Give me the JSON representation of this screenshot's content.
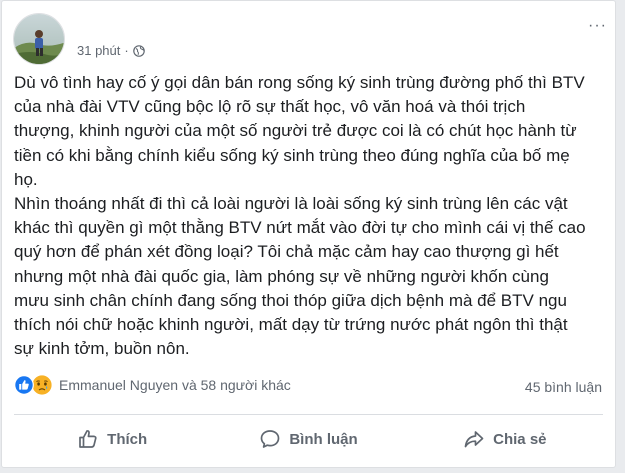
{
  "post": {
    "time": "31 phút",
    "privacy_icon": "globe-icon",
    "menu_label": "···",
    "paragraphs": [
      "Dù vô tình hay cố ý gọi dân bán rong sống ký sinh trùng đường phố thì BTV\ncủa nhà đài VTV cũng bộc lộ rõ sự thất học, vô văn hoá và thói trịch\nthượng, khinh người của một số người trẻ được coi là có chút học hành từ\ntiền có khi bằng chính kiểu sống ký sinh trùng theo đúng nghĩa của bố mẹ\nhọ.",
      "Nhìn thoáng nhất đi thì cả loài người là loài sống ký sinh trùng lên các vật\nkhác thì quyền gì một thằng BTV nứt mắt vào đời tự cho mình cái vị thế cao\nquý hơn để phán xét đồng loại? Tôi chả mặc cảm hay cao thượng gì hết\nnhưng một nhà đài quốc gia, làm phóng sự về những người khốn cùng\nmưu sinh chân chính đang sống thoi thóp giữa dịch bệnh mà để BTV ngu\nthích nói chữ hoặc khinh người, mất dạy từ trứng nước phát ngôn thì thật\nsự kinh tởm, buồn nôn."
    ]
  },
  "reactions": {
    "names": "Emmanuel Nguyen và 58 người khác",
    "icons": [
      "like-reaction-icon",
      "sad-reaction-icon"
    ],
    "like_color": "#1877f2",
    "sad_color": "#f7b125"
  },
  "comments_count": "45 bình luận",
  "actions": {
    "like": "Thích",
    "comment": "Bình luận",
    "share": "Chia sẻ"
  }
}
